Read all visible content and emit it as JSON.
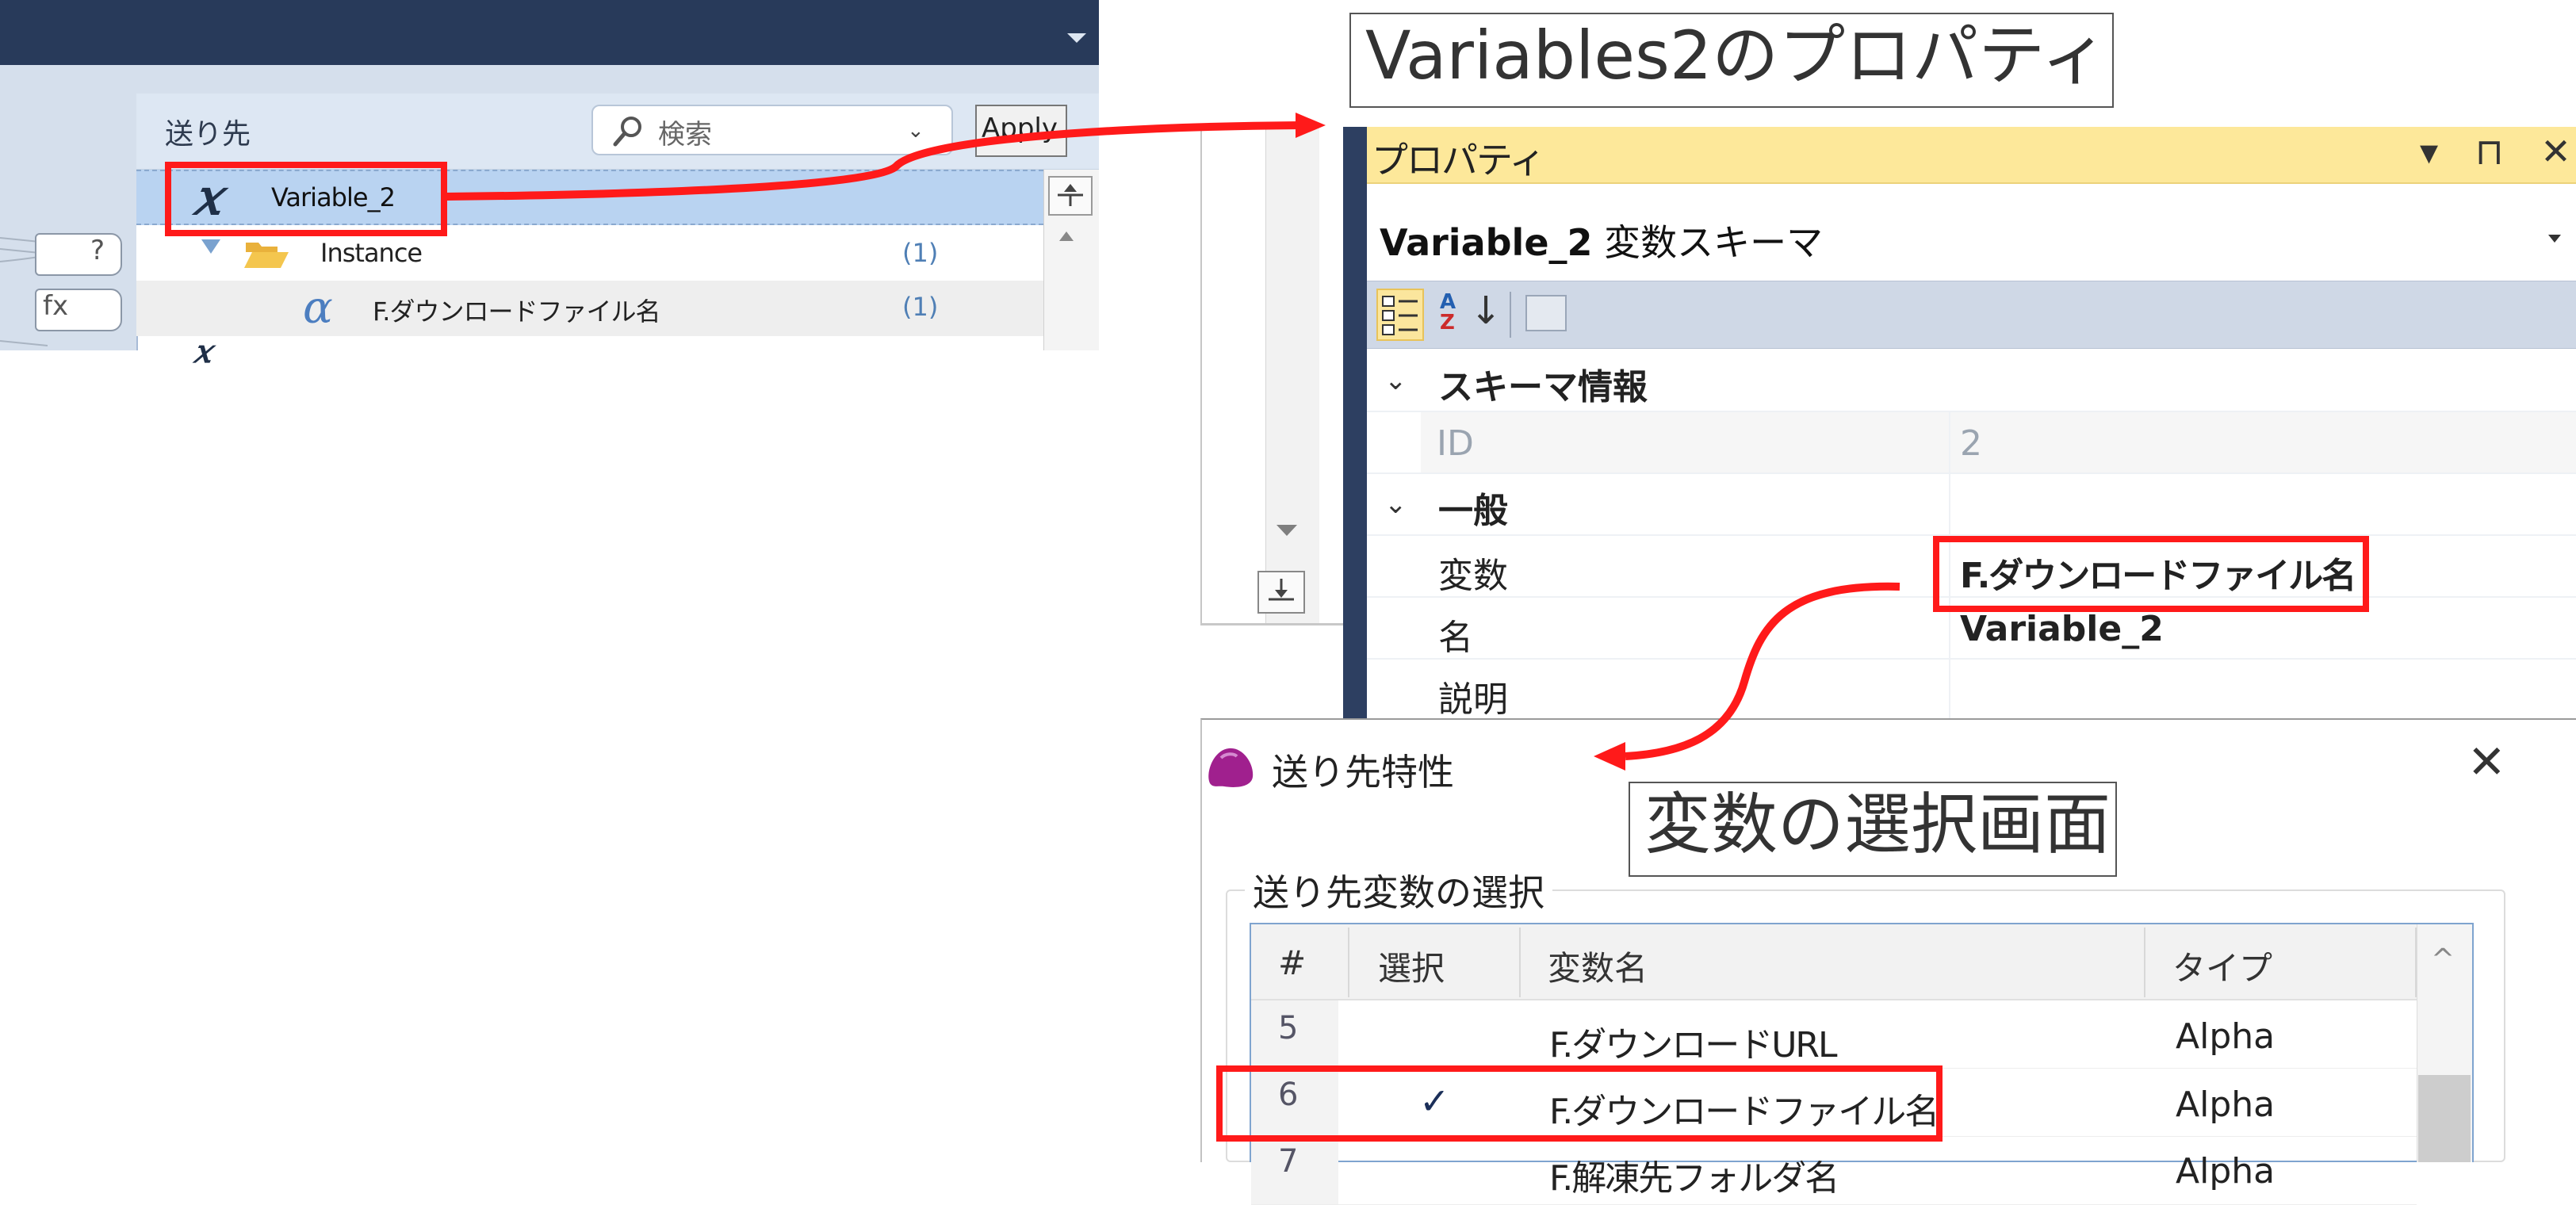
{
  "colors": {
    "highlight_red": "#ff1a1a",
    "properties_title_bg": "#fde89a",
    "navy_titlebar": "#283a5a",
    "selected_row": "#b9d3f1",
    "dialog_icon": "#a0208e"
  },
  "icons": {
    "variable": "italic-x-variable-icon",
    "folder": "open-folder-icon",
    "alpha": "alpha-type-icon",
    "search": "magnifier-icon",
    "dialog": "purple-blob-app-icon"
  },
  "captions": {
    "properties": "Variables2のプロパティ",
    "selection_screen": "変数の選択画面"
  },
  "destination_panel": {
    "header_label": "送り先",
    "search_placeholder": "検索",
    "search_dropdown": "⌄",
    "apply_button": "Apply",
    "tags": {
      "unknown": "?",
      "function": "fx"
    },
    "tree": [
      {
        "icon": "𝑥",
        "label": "Variable_2",
        "count": ""
      },
      {
        "label": "Instance",
        "count": "(1)"
      },
      {
        "icon": "α",
        "label": "F.ダウンロードファイル名",
        "count": "(1)"
      }
    ],
    "next_icon": "𝑥"
  },
  "properties_panel": {
    "title": "プロパティ",
    "window_controls": "▾ ⊓ ✕",
    "selector": {
      "name": "Variable_2",
      "type": "変数スキーマ"
    },
    "toolbar": {
      "alpha_a": "A",
      "alpha_z": "Z",
      "sort_arrow": "↓"
    },
    "categories": [
      {
        "chevron": "⌄",
        "label": "スキーマ情報"
      },
      {
        "chevron": "⌄",
        "label": "一般"
      }
    ],
    "rows": [
      {
        "name": "ID",
        "value": "2"
      },
      {
        "name": "変数",
        "value": "F.ダウンロードファイル名"
      },
      {
        "name": "名",
        "value": "Variable_2"
      },
      {
        "name": "説明",
        "value": ""
      }
    ]
  },
  "dest_dialog": {
    "title": "送り先特性",
    "close": "✕",
    "group_label": "送り先変数の選択",
    "columns": [
      "#",
      "選択",
      "変数名",
      "タイプ"
    ],
    "scroll_up": "^",
    "rows": [
      {
        "num": "5",
        "checked": "",
        "name": "F.ダウンロードURL",
        "type": "Alpha"
      },
      {
        "num": "6",
        "checked": "✓",
        "name": "F.ダウンロードファイル名",
        "type": "Alpha"
      },
      {
        "num": "7",
        "checked": "",
        "name": "F.解凍先フォルダ名",
        "type": "Alpha"
      }
    ]
  }
}
